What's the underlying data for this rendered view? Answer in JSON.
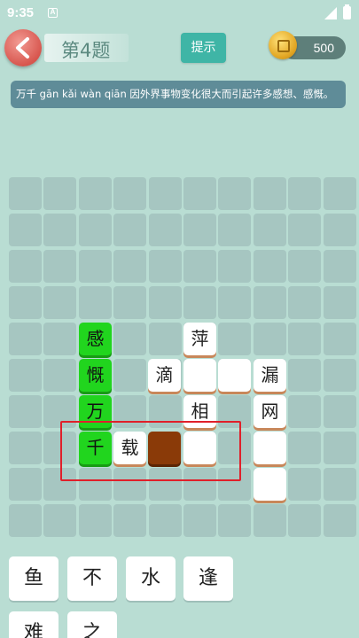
{
  "status": {
    "time": "9:35",
    "notification": "A"
  },
  "header": {
    "level_title": "第4题",
    "hint_label": "提示",
    "coins": "500"
  },
  "definition": {
    "text": "万千  gān kǎi wàn qiān  因外界事物变化很大而引起许多感想、感慨。"
  },
  "board": {
    "tiles": [
      {
        "char": "感"
      },
      {
        "char": "慨"
      },
      {
        "char": "万"
      },
      {
        "char": "千"
      },
      {
        "char": "萍"
      },
      {
        "char": "滴"
      },
      {
        "char": ""
      },
      {
        "char": ""
      },
      {
        "char": "漏"
      },
      {
        "char": "相"
      },
      {
        "char": "网"
      },
      {
        "char": "载"
      },
      {
        "char": ""
      },
      {
        "char": ""
      },
      {
        "char": ""
      },
      {
        "char": ""
      }
    ]
  },
  "candidates": [
    "鱼",
    "不",
    "水",
    "逢",
    "难",
    "之"
  ],
  "colors": {
    "background": "#b9ddd3",
    "accent": "#3fb5a6",
    "solved": "#21d51e",
    "selected": "#8a3a08",
    "highlight": "#e0202a"
  }
}
